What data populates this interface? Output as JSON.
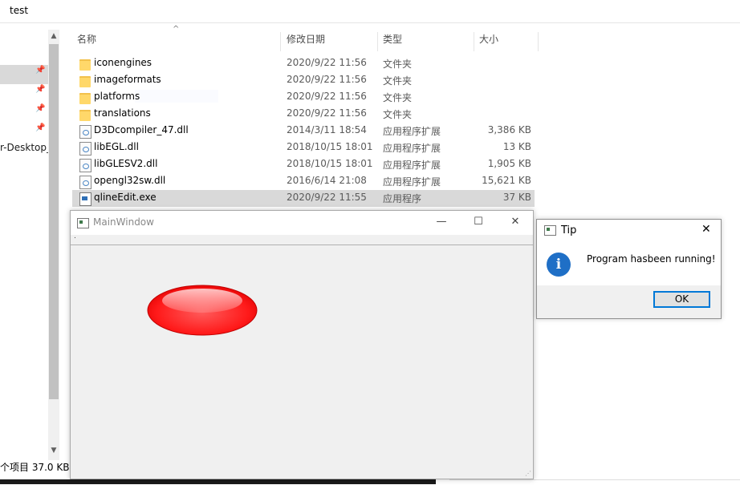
{
  "explorer": {
    "title": "test",
    "sort_arrow": "^",
    "columns": [
      "名称",
      "修改日期",
      "类型",
      "大小"
    ],
    "nav": {
      "desktop_label": "r-Desktop_",
      "pin_icon": "pin-icon"
    },
    "files": [
      {
        "name": "iconengines",
        "date": "2020/9/22 11:56",
        "type": "文件夹",
        "size": "",
        "icon": "folder-icon"
      },
      {
        "name": "imageformats",
        "date": "2020/9/22 11:56",
        "type": "文件夹",
        "size": "",
        "icon": "folder-icon"
      },
      {
        "name": "platforms",
        "date": "2020/9/22 11:56",
        "type": "文件夹",
        "size": "",
        "icon": "folder-icon"
      },
      {
        "name": "translations",
        "date": "2020/9/22 11:56",
        "type": "文件夹",
        "size": "",
        "icon": "folder-icon"
      },
      {
        "name": "D3Dcompiler_47.dll",
        "date": "2014/3/11 18:54",
        "type": "应用程序扩展",
        "size": "3,386 KB",
        "icon": "dll-file-icon"
      },
      {
        "name": "libEGL.dll",
        "date": "2018/10/15 18:01",
        "type": "应用程序扩展",
        "size": "13 KB",
        "icon": "dll-file-icon"
      },
      {
        "name": "libGLESV2.dll",
        "date": "2018/10/15 18:01",
        "type": "应用程序扩展",
        "size": "1,905 KB",
        "icon": "dll-file-icon"
      },
      {
        "name": "opengl32sw.dll",
        "date": "2016/6/14 21:08",
        "type": "应用程序扩展",
        "size": "15,621 KB",
        "icon": "dll-file-icon"
      },
      {
        "name": "qlineEdit.exe",
        "date": "2020/9/22 11:55",
        "type": "应用程序",
        "size": "37 KB",
        "icon": "exe-file-icon",
        "selected": true
      }
    ],
    "status": "个项目  37.0 KB"
  },
  "main_window": {
    "title": "MainWindow",
    "menu_dot": ".",
    "controls": {
      "minimize": "—",
      "maximize": "☐",
      "close": "✕"
    },
    "ellipse_color": "#ff0000"
  },
  "tip_dialog": {
    "title": "Tip",
    "close": "✕",
    "info_glyph": "i",
    "message": "Program hasbeen running!",
    "ok_label": "OK"
  }
}
